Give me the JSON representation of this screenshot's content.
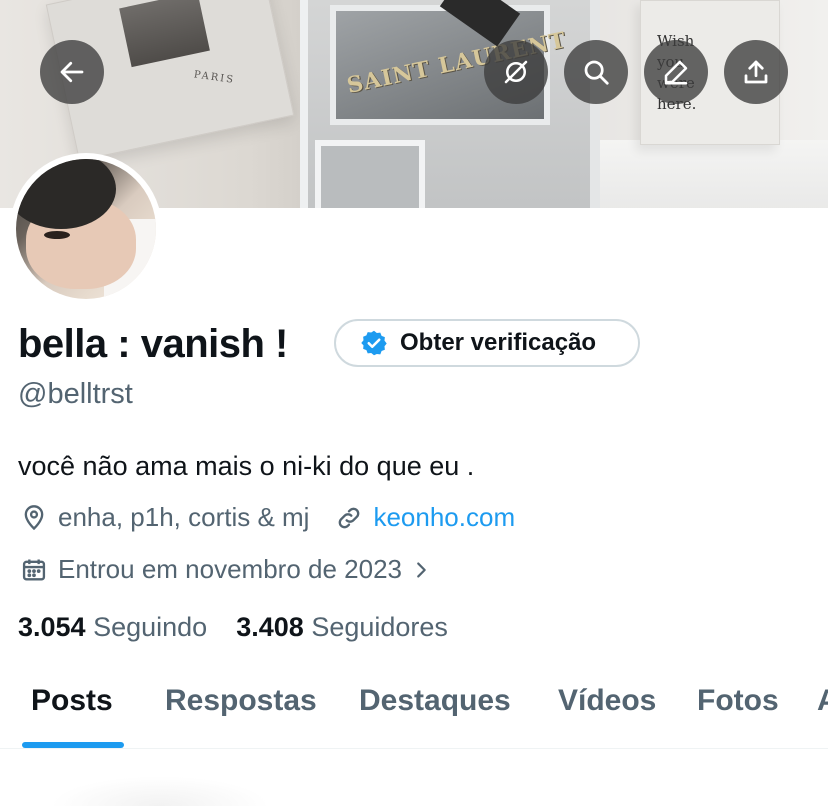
{
  "banner": {
    "store_sign": "SAINT LAURENT",
    "book_text": "PARIS",
    "note_text": "Wish you were here."
  },
  "actions": {
    "back_icon": "arrow-left-icon",
    "grok_icon": "grok-icon",
    "search_icon": "search-icon",
    "edit_icon": "edit-icon",
    "share_icon": "share-icon"
  },
  "profile": {
    "display_name": "bella : vanish !",
    "verify_label": "Obter verificação",
    "handle": "@belltrst",
    "bio": "você não ama mais o ni-ki do que eu .",
    "location": "enha, p1h, cortis & mj",
    "website": "keonho.com",
    "joined": "Entrou em novembro de 2023",
    "following_count": "3.054",
    "following_label": "Seguindo",
    "followers_count": "3.408",
    "followers_label": "Seguidores"
  },
  "tabs": [
    {
      "label": "Posts",
      "active": true
    },
    {
      "label": "Respostas",
      "active": false
    },
    {
      "label": "Destaques",
      "active": false
    },
    {
      "label": "Vídeos",
      "active": false
    },
    {
      "label": "Fotos",
      "active": false
    },
    {
      "label": "A",
      "active": false
    }
  ],
  "colors": {
    "accent": "#1d9bf0",
    "text_primary": "#0f1419",
    "text_secondary": "#536471"
  }
}
